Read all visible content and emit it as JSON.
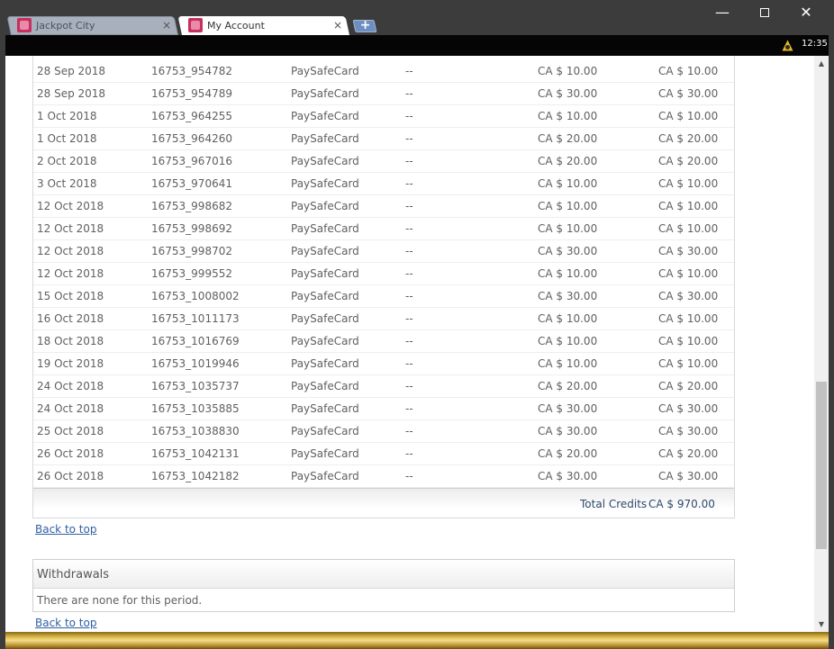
{
  "tabs": [
    {
      "title": "Jackpot City",
      "close": "×",
      "favicon": "jackpot-city-favicon-icon"
    },
    {
      "title": "My Account",
      "close": "×",
      "favicon": "jackpot-city-favicon-icon"
    }
  ],
  "new_tab": "+",
  "window_controls": {
    "minimize": "—",
    "close": "✕"
  },
  "topbar": {
    "time": "12:35",
    "coin_icon": "coin-icon"
  },
  "credits": {
    "rows": [
      {
        "date": "28 Sep 2018",
        "ref": "16753_954782",
        "method": "PaySafeCard",
        "note": "--",
        "amount": "CA $ 10.00",
        "balance": "CA $ 10.00"
      },
      {
        "date": "28 Sep 2018",
        "ref": "16753_954789",
        "method": "PaySafeCard",
        "note": "--",
        "amount": "CA $ 30.00",
        "balance": "CA $ 30.00"
      },
      {
        "date": "1 Oct 2018",
        "ref": "16753_964255",
        "method": "PaySafeCard",
        "note": "--",
        "amount": "CA $ 10.00",
        "balance": "CA $ 10.00"
      },
      {
        "date": "1 Oct 2018",
        "ref": "16753_964260",
        "method": "PaySafeCard",
        "note": "--",
        "amount": "CA $ 20.00",
        "balance": "CA $ 20.00"
      },
      {
        "date": "2 Oct 2018",
        "ref": "16753_967016",
        "method": "PaySafeCard",
        "note": "--",
        "amount": "CA $ 20.00",
        "balance": "CA $ 20.00"
      },
      {
        "date": "3 Oct 2018",
        "ref": "16753_970641",
        "method": "PaySafeCard",
        "note": "--",
        "amount": "CA $ 10.00",
        "balance": "CA $ 10.00"
      },
      {
        "date": "12 Oct 2018",
        "ref": "16753_998682",
        "method": "PaySafeCard",
        "note": "--",
        "amount": "CA $ 10.00",
        "balance": "CA $ 10.00"
      },
      {
        "date": "12 Oct 2018",
        "ref": "16753_998692",
        "method": "PaySafeCard",
        "note": "--",
        "amount": "CA $ 10.00",
        "balance": "CA $ 10.00"
      },
      {
        "date": "12 Oct 2018",
        "ref": "16753_998702",
        "method": "PaySafeCard",
        "note": "--",
        "amount": "CA $ 30.00",
        "balance": "CA $ 30.00"
      },
      {
        "date": "12 Oct 2018",
        "ref": "16753_999552",
        "method": "PaySafeCard",
        "note": "--",
        "amount": "CA $ 10.00",
        "balance": "CA $ 10.00"
      },
      {
        "date": "15 Oct 2018",
        "ref": "16753_1008002",
        "method": "PaySafeCard",
        "note": "--",
        "amount": "CA $ 30.00",
        "balance": "CA $ 30.00"
      },
      {
        "date": "16 Oct 2018",
        "ref": "16753_1011173",
        "method": "PaySafeCard",
        "note": "--",
        "amount": "CA $ 10.00",
        "balance": "CA $ 10.00"
      },
      {
        "date": "18 Oct 2018",
        "ref": "16753_1016769",
        "method": "PaySafeCard",
        "note": "--",
        "amount": "CA $ 10.00",
        "balance": "CA $ 10.00"
      },
      {
        "date": "19 Oct 2018",
        "ref": "16753_1019946",
        "method": "PaySafeCard",
        "note": "--",
        "amount": "CA $ 10.00",
        "balance": "CA $ 10.00"
      },
      {
        "date": "24 Oct 2018",
        "ref": "16753_1035737",
        "method": "PaySafeCard",
        "note": "--",
        "amount": "CA $ 20.00",
        "balance": "CA $ 20.00"
      },
      {
        "date": "24 Oct 2018",
        "ref": "16753_1035885",
        "method": "PaySafeCard",
        "note": "--",
        "amount": "CA $ 30.00",
        "balance": "CA $ 30.00"
      },
      {
        "date": "25 Oct 2018",
        "ref": "16753_1038830",
        "method": "PaySafeCard",
        "note": "--",
        "amount": "CA $ 30.00",
        "balance": "CA $ 30.00"
      },
      {
        "date": "26 Oct 2018",
        "ref": "16753_1042131",
        "method": "PaySafeCard",
        "note": "--",
        "amount": "CA $ 20.00",
        "balance": "CA $ 20.00"
      },
      {
        "date": "26 Oct 2018",
        "ref": "16753_1042182",
        "method": "PaySafeCard",
        "note": "--",
        "amount": "CA $ 30.00",
        "balance": "CA $ 30.00"
      }
    ],
    "total_label": "Total Credits",
    "total_value": "CA $ 970.00"
  },
  "back_to_top": "Back to top",
  "withdrawals": {
    "title": "Withdrawals",
    "empty_text": "There are none for this period."
  },
  "colors": {
    "link": "#2f5fa3",
    "total_text": "#2c4a6e",
    "accent_gold": "#e7c45a"
  }
}
